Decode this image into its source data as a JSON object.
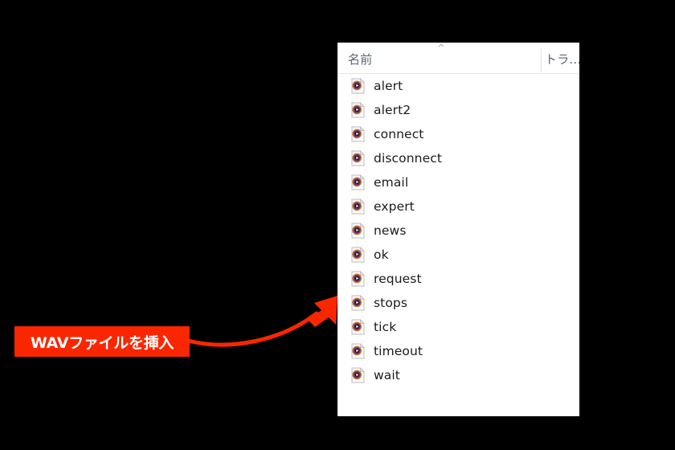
{
  "annotation": {
    "banner_text": "WAVファイルを挿入",
    "banner_color": "#fa2600",
    "banner_text_color": "#ffffff",
    "arrow_color": "#fa2600",
    "arrow_target": "request"
  },
  "file_panel": {
    "background": "#ffffff",
    "columns": [
      {
        "label": "名前",
        "sort_indicator": "ascending",
        "caret_glyph": "︿"
      },
      {
        "label": "トラ...",
        "sort_indicator": "none"
      }
    ],
    "sort_caret_glyph": "^",
    "items": [
      {
        "name": "alert",
        "icon": "media-file-icon"
      },
      {
        "name": "alert2",
        "icon": "media-file-icon"
      },
      {
        "name": "connect",
        "icon": "media-file-icon"
      },
      {
        "name": "disconnect",
        "icon": "media-file-icon"
      },
      {
        "name": "email",
        "icon": "media-file-icon"
      },
      {
        "name": "expert",
        "icon": "media-file-icon"
      },
      {
        "name": "news",
        "icon": "media-file-icon"
      },
      {
        "name": "ok",
        "icon": "media-file-icon"
      },
      {
        "name": "request",
        "icon": "media-file-icon"
      },
      {
        "name": "stops",
        "icon": "media-file-icon"
      },
      {
        "name": "tick",
        "icon": "media-file-icon"
      },
      {
        "name": "timeout",
        "icon": "media-file-icon"
      },
      {
        "name": "wait",
        "icon": "media-file-icon"
      }
    ]
  }
}
